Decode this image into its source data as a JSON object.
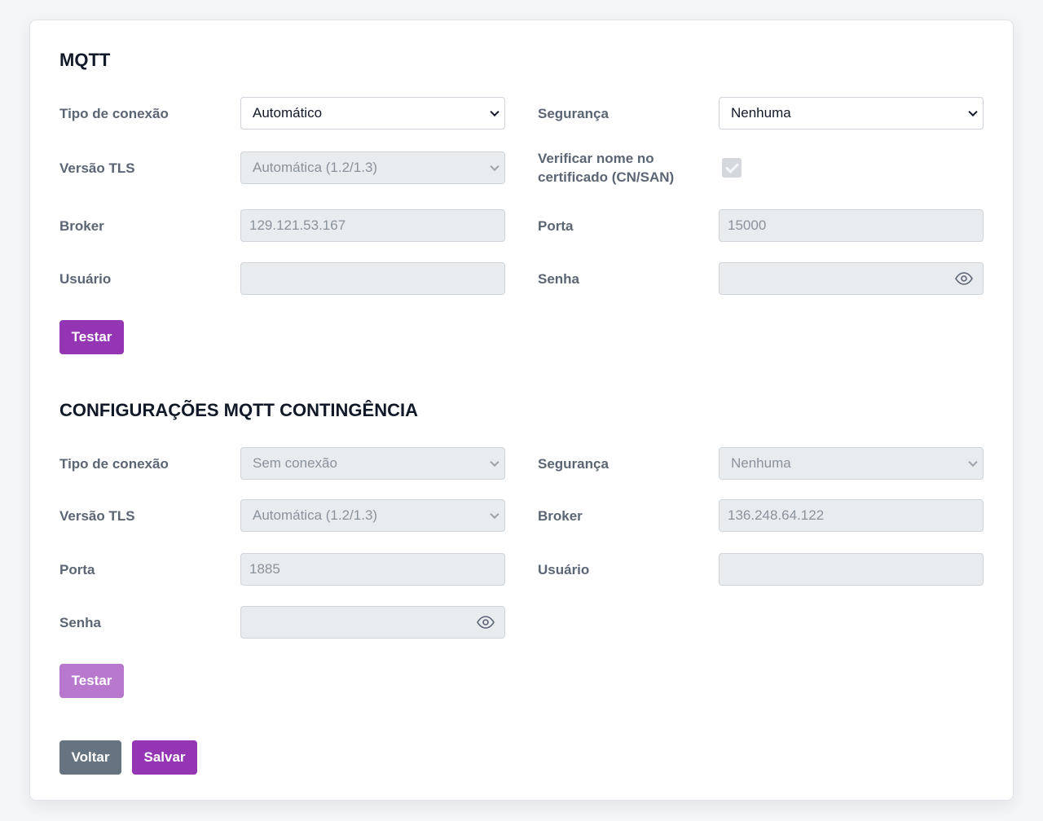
{
  "mqtt": {
    "title": "MQTT",
    "tipo_conexao": {
      "label": "Tipo de conexão",
      "value": "Automático"
    },
    "seguranca": {
      "label": "Segurança",
      "value": "Nenhuma"
    },
    "versao_tls": {
      "label": "Versão TLS",
      "value": "Automática (1.2/1.3)"
    },
    "verificar_nome": {
      "label": "Verificar nome no certificado (CN/SAN)",
      "checked": true
    },
    "broker": {
      "label": "Broker",
      "value": "129.121.53.167"
    },
    "porta": {
      "label": "Porta",
      "value": "15000"
    },
    "usuario": {
      "label": "Usuário",
      "value": ""
    },
    "senha": {
      "label": "Senha",
      "value": ""
    },
    "test_button": "Testar"
  },
  "contingencia": {
    "title": "CONFIGURAÇÕES MQTT CONTINGÊNCIA",
    "tipo_conexao": {
      "label": "Tipo de conexão",
      "value": "Sem conexão"
    },
    "seguranca": {
      "label": "Segurança",
      "value": "Nenhuma"
    },
    "versao_tls": {
      "label": "Versão TLS",
      "value": "Automática (1.2/1.3)"
    },
    "broker": {
      "label": "Broker",
      "value": "136.248.64.122"
    },
    "porta": {
      "label": "Porta",
      "value": "1885"
    },
    "usuario": {
      "label": "Usuário",
      "value": ""
    },
    "senha": {
      "label": "Senha",
      "value": ""
    },
    "test_button": "Testar"
  },
  "actions": {
    "back": "Voltar",
    "save": "Salvar"
  },
  "colors": {
    "primary": "#9436b3",
    "primary_disabled": "#b878cd",
    "secondary": "#667482"
  },
  "icons": {
    "password_toggle": "eye-icon"
  }
}
